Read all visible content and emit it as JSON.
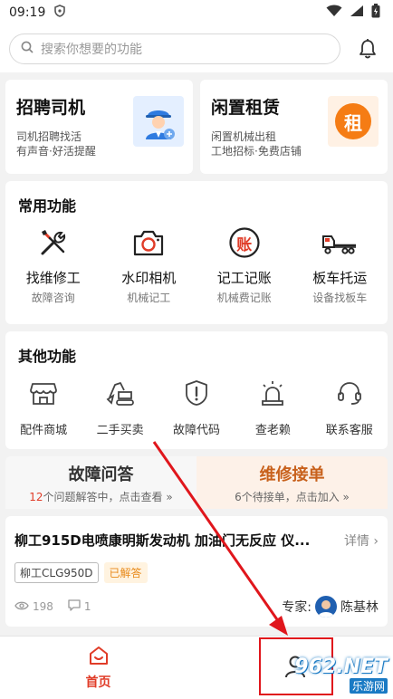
{
  "status_bar": {
    "time": "09:19",
    "icons": [
      "shield-icon",
      "wifi-icon",
      "signal-icon",
      "battery-icon"
    ]
  },
  "search": {
    "placeholder": "搜索你想要的功能"
  },
  "top_cards": [
    {
      "title": "招聘司机",
      "line1": "司机招聘找活",
      "line2": "有声音·好活提醒",
      "icon": "driver-icon"
    },
    {
      "title": "闲置租赁",
      "line1": "闲置机械出租",
      "line2": "工地招标·免费店铺",
      "icon_text": "租"
    }
  ],
  "common": {
    "title": "常用功能",
    "items": [
      {
        "label": "找维修工",
        "sub": "故障咨询",
        "icon": "tools-icon"
      },
      {
        "label": "水印相机",
        "sub": "机械记工",
        "icon": "camera-icon"
      },
      {
        "label": "记工记账",
        "sub": "机械费记账",
        "icon": "ledger-icon",
        "icon_text": "账"
      },
      {
        "label": "板车托运",
        "sub": "设备找板车",
        "icon": "truck-icon"
      }
    ]
  },
  "other": {
    "title": "其他功能",
    "items": [
      {
        "label": "配件商城",
        "icon": "shop-icon"
      },
      {
        "label": "二手买卖",
        "icon": "excavator-icon"
      },
      {
        "label": "故障代码",
        "icon": "alert-icon"
      },
      {
        "label": "查老赖",
        "icon": "siren-icon"
      },
      {
        "label": "联系客服",
        "icon": "headset-icon"
      }
    ]
  },
  "tabs": {
    "left": {
      "title": "故障问答",
      "count": "12",
      "sub": "个问题解答中，点击查看 »"
    },
    "right": {
      "title": "维修接单",
      "count": "6",
      "sub": "个待接单，点击加入 »"
    }
  },
  "question": {
    "title": "柳工915D电喷康明斯发动机 加油门无反应 仪...",
    "more": "详情 ›",
    "model_tag": "柳工CLG950D",
    "status_tag": "已解答",
    "views": "198",
    "comments": "1",
    "expert_label": "专家:",
    "expert_name": "陈基林"
  },
  "bottom_nav": {
    "home": "首页"
  },
  "watermark": {
    "logo": "962.NET",
    "sub": "乐游网"
  },
  "colors": {
    "accent": "#e03c28",
    "orange": "#f57c14",
    "annotation": "#e0161c"
  }
}
